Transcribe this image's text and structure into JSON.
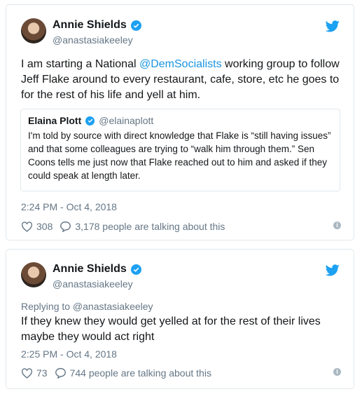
{
  "tweets": [
    {
      "author_name": "Annie Shields",
      "author_handle": "@anastasiakeeley",
      "text_before": "I am starting a National ",
      "mention": "@DemSocialists",
      "text_after": " working group to follow Jeff Flake around to every restaurant, cafe, store, etc he goes to for the rest of his life and yell at him.",
      "quote": {
        "author_name": "Elaina Plott",
        "author_handle": "@elainaplott",
        "text": "I'm told by source with direct knowledge that Flake is “still having issues” and that some colleagues are trying to “walk him through them.” Sen Coons tells me just now that Flake reached out to him and asked if they could speak at length later."
      },
      "timestamp": "2:24 PM - Oct 4, 2018",
      "likes": "308",
      "talking": "3,178 people are talking about this"
    },
    {
      "author_name": "Annie Shields",
      "author_handle": "@anastasiakeeley",
      "replying_to": "Replying to @anastasiakeeley",
      "text": "If they knew they would get yelled at for the rest of their lives maybe they would act right",
      "timestamp": "2:25 PM - Oct 4, 2018",
      "likes": "73",
      "talking": "744 people are talking about this"
    }
  ],
  "icons": {
    "verified": "verified-badge-icon",
    "bird": "twitter-bird-icon",
    "like": "heart-icon",
    "reply": "speech-bubble-icon",
    "info": "info-icon"
  },
  "colors": {
    "accent": "#1da1f2",
    "link": "#1b95e0",
    "muted": "#657786",
    "border": "#e1e8ed"
  }
}
